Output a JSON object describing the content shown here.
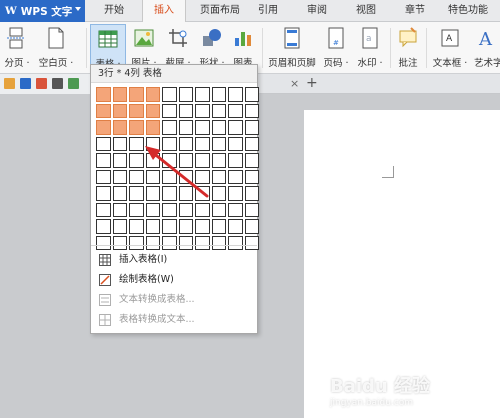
{
  "app_menu": {
    "label": "WPS 文字",
    "logo": "W"
  },
  "ribbon_tabs": [
    {
      "label": "开始",
      "active": false
    },
    {
      "label": "插入",
      "active": true
    },
    {
      "label": "页面布局",
      "active": false
    },
    {
      "label": "引用",
      "active": false
    },
    {
      "label": "审阅",
      "active": false
    },
    {
      "label": "视图",
      "active": false
    },
    {
      "label": "章节",
      "active": false
    },
    {
      "label": "特色功能",
      "active": false
    }
  ],
  "ribbon_buttons": [
    {
      "label": "分页 ·",
      "icon": "page-break-icon"
    },
    {
      "label": "空白页 ·",
      "icon": "blank-page-icon"
    },
    {
      "label": "表格 ·",
      "icon": "table-icon"
    },
    {
      "label": "图片 ·",
      "icon": "picture-icon"
    },
    {
      "label": "截屏 ·",
      "icon": "screenshot-icon"
    },
    {
      "label": "形状 ·",
      "icon": "shapes-icon"
    },
    {
      "label": "图表",
      "icon": "chart-icon"
    },
    {
      "label": "页眉和页脚",
      "icon": "header-footer-icon"
    },
    {
      "label": "页码 ·",
      "icon": "page-number-icon"
    },
    {
      "label": "水印 ·",
      "icon": "watermark-icon"
    },
    {
      "label": "批注",
      "icon": "comment-icon"
    },
    {
      "label": "文本框 ·",
      "icon": "textbox-icon"
    },
    {
      "label": "艺术字",
      "icon": "wordart-icon"
    }
  ],
  "doc_tabs": {
    "close": "×",
    "add": "+"
  },
  "table_dropdown": {
    "header": "3行 * 4列 表格",
    "grid": {
      "rows": 10,
      "cols": 10,
      "selected_rows": 3,
      "selected_cols": 4
    },
    "menu": [
      {
        "label": "插入表格(I)",
        "enabled": true,
        "icon": "insert-table-icon"
      },
      {
        "label": "绘制表格(W)",
        "enabled": true,
        "icon": "draw-table-icon"
      },
      {
        "label": "文本转换成表格...",
        "enabled": false,
        "icon": "text-to-table-icon"
      },
      {
        "label": "表格转换成文本...",
        "enabled": false,
        "icon": "table-to-text-icon"
      }
    ]
  },
  "watermark": {
    "text": "Baidu 经验",
    "sub": "jingyan.baidu.com"
  },
  "colors": {
    "accent": "#2b6ac7",
    "active_tab": "#d9501f",
    "cell_selected": "#f4a579",
    "arrow": "#d42a2a"
  }
}
